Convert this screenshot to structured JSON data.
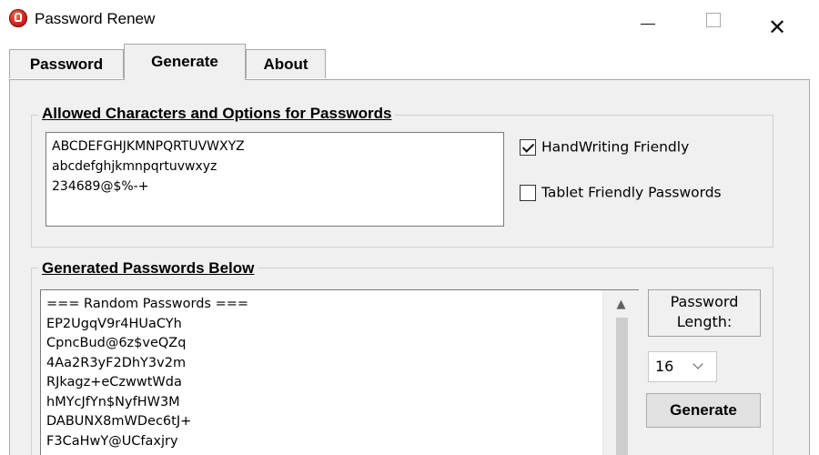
{
  "window": {
    "title": "Password Renew",
    "icon": "app-lock-icon",
    "controls": {
      "minimize": "minimize-icon",
      "maximize": "maximize-icon",
      "close": "close-icon"
    }
  },
  "tabs": [
    {
      "label": "Password",
      "selected": false
    },
    {
      "label": "Generate",
      "selected": true
    },
    {
      "label": "About",
      "selected": false
    }
  ],
  "allowed": {
    "legend": "Allowed Characters and Options for Passwords",
    "lines": [
      "ABCDEFGHJKMNPQRTUVWXYZ",
      "abcdefghjkmnpqrtuvwxyz",
      "234689@$%-+"
    ],
    "options": [
      {
        "label": "HandWriting Friendly",
        "checked": true
      },
      {
        "label": "Tablet Friendly Passwords",
        "checked": false
      }
    ]
  },
  "generated": {
    "legend": "Generated Passwords Below",
    "lines": [
      "=== Random Passwords ===",
      "EP2UgqV9r4HUaCYh",
      "CpncBud@6z$veQZq",
      "4Aa2R3yF2DhY3v2m",
      "RJkagz+eCzwwtWda",
      "hMYcJfYn$NyfHW3M",
      "DABUNX8mWDec6tJ+",
      "F3CaHwY@UCfaxjry"
    ],
    "length_label_1": "Password",
    "length_label_2": "Length:",
    "length_value": "16",
    "generate_label": "Generate"
  }
}
